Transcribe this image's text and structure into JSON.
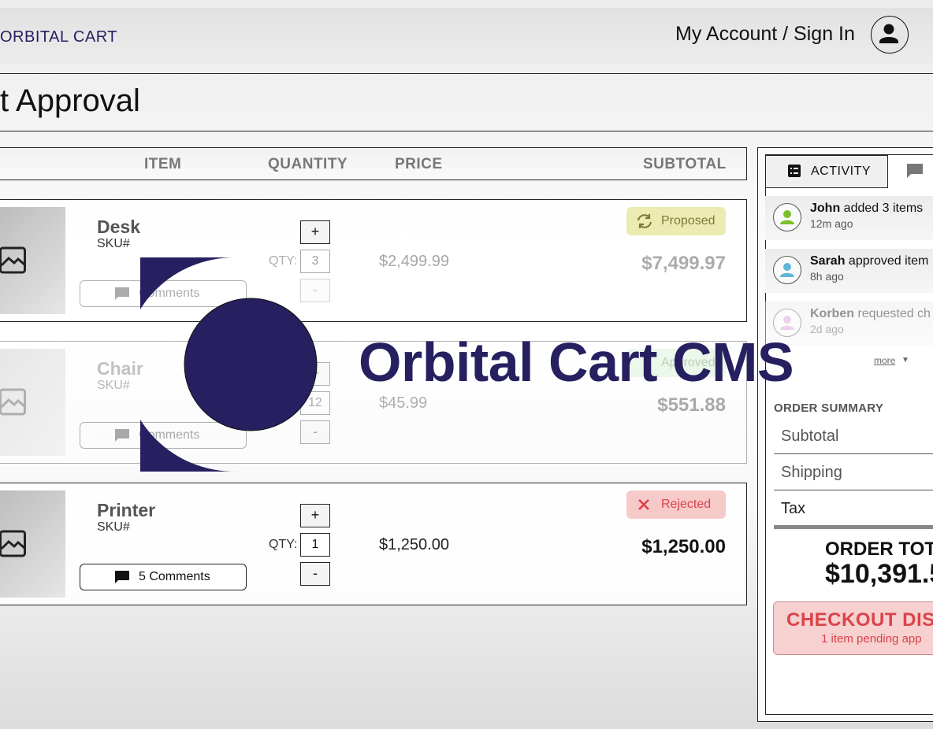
{
  "header": {
    "brand": "ORBITAL CART",
    "account_link": "My Account / Sign In",
    "page_title": "t Approval"
  },
  "table": {
    "columns": [
      "ITEM",
      "QUANTITY",
      "PRICE",
      "SUBTOTAL"
    ],
    "qty_label": "QTY:",
    "plus": "+",
    "minus": "-",
    "rows": [
      {
        "name": "Desk",
        "sku": "SKU#",
        "comments": "Comments",
        "qty": "3",
        "price": "$2,499.99",
        "status": "Proposed",
        "subtotal": "$7,499.97"
      },
      {
        "name": "Chair",
        "sku": "SKU#",
        "comments": "Comments",
        "qty": "12",
        "price": "$45.99",
        "status": "Approved",
        "subtotal": "$551.88"
      },
      {
        "name": "Printer",
        "sku": "SKU#",
        "comments": "5 Comments",
        "qty": "1",
        "price": "$1,250.00",
        "status": "Rejected",
        "subtotal": "$1,250.00"
      }
    ]
  },
  "activity": {
    "tab_label": "ACTIVITY",
    "items": [
      {
        "user": "John",
        "action": " added 3 items",
        "time": "12m ago",
        "avatar_color": "#7bbf2a"
      },
      {
        "user": "Sarah",
        "action": " approved item",
        "time": "8h ago",
        "avatar_color": "#5fb6d6"
      },
      {
        "user": "Korben",
        "action": " requested ch",
        "time": "2d ago",
        "avatar_color": "#d49ad6"
      }
    ],
    "more": "more"
  },
  "summary": {
    "heading": "ORDER SUMMARY",
    "rows": [
      "Subtotal",
      "Shipping",
      "Tax"
    ],
    "total_label": "ORDER TOT",
    "total_value": "$10,391.5",
    "checkout_label": "CHECKOUT DIS",
    "checkout_sub": "1 item pending app"
  },
  "watermark": {
    "text": "Orbital Cart CMS"
  },
  "colors": {
    "brand": "#262060",
    "proposed_bg": "#ecebb2",
    "proposed_fg": "#7c7a3a",
    "approved_bg": "#cfeecd",
    "rejected_bg": "#f7caca",
    "rejected_fg": "#d9434a"
  }
}
